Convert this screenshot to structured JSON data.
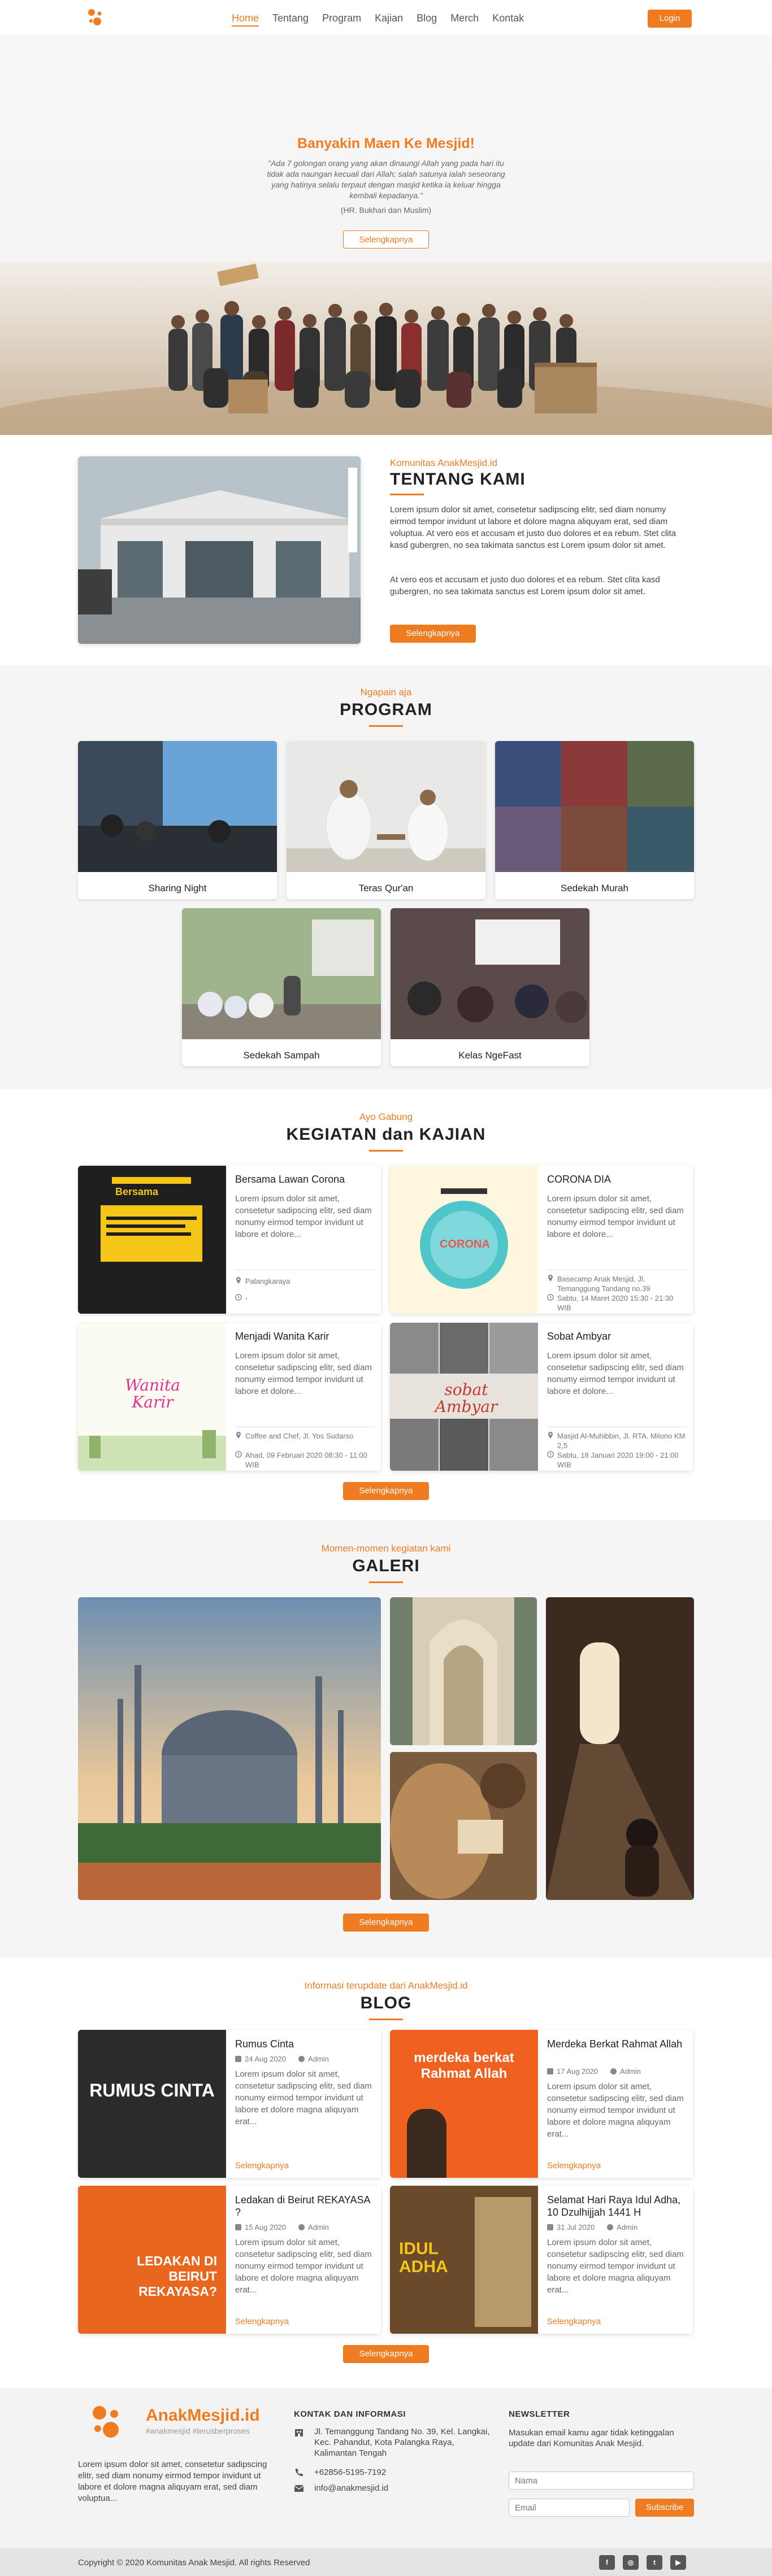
{
  "nav": {
    "items": [
      "Home",
      "Tentang",
      "Program",
      "Kajian",
      "Blog",
      "Merch",
      "Kontak"
    ],
    "active": "Home",
    "login": "Login"
  },
  "hero": {
    "title": "Banyakin Maen Ke Mesjid!",
    "quote": "\"Ada 7 golongan orang yang akan dinaungi Allah yang pada hari itu tidak ada naungan kecuali dari Allah; salah satunya ialah seseorang yang hatinya selalu terpaut dengan masjid ketika ia keluar hingga kembali kepadanya.\"",
    "cite": "(HR. Bukhari dan Muslim)",
    "button": "Selengkapnya"
  },
  "about": {
    "subtitle": "Komunitas AnakMesjid.id",
    "title": "TENTANG KAMI",
    "p1": "Lorem ipsum dolor sit amet, consetetur sadipscing elitr, sed diam nonumy eirmod tempor invidunt ut labore et dolore magna aliquyam erat, sed diam voluptua. At vero eos et accusam et justo duo dolores et ea rebum. Stet clita kasd gubergren, no sea takimata sanctus est Lorem ipsum dolor sit amet.",
    "p2": "At vero eos et accusam et justo duo dolores et ea rebum. Stet clita kasd gubergren, no sea takimata sanctus est Lorem ipsum dolor sit amet.",
    "button": "Selengkapnya"
  },
  "program": {
    "subtitle": "Ngapain aja",
    "title": "PROGRAM",
    "cards": [
      "Sharing Night",
      "Teras Qur'an",
      "Sedekah Murah",
      "Sedekah Sampah",
      "Kelas NgeFast"
    ]
  },
  "kajian": {
    "subtitle": "Ayo Gabung",
    "title": "KEGIATAN dan KAJIAN",
    "cards": [
      {
        "title": "Bersama Lawan Corona",
        "desc": "Lorem ipsum dolor sit amet, consetetur sadipscing elitr, sed diam nonumy eirmod tempor invidunt ut labore et dolore...",
        "place": "Palangkaraya",
        "time": "-"
      },
      {
        "title": "CORONA DIA",
        "desc": "Lorem ipsum dolor sit amet, consetetur sadipscing elitr, sed diam nonumy eirmod tempor invidunt ut labore et dolore...",
        "place": "Basecamp Anak Mesjid, Jl. Temanggung Tandang no.39",
        "time": "Sabtu, 14 Maret 2020 15:30 - 21:30 WIB"
      },
      {
        "title": "Menjadi Wanita Karir",
        "desc": "Lorem ipsum dolor sit amet, consetetur sadipscing elitr, sed diam nonumy eirmod tempor invidunt ut labore et dolore...",
        "place": "Coffee and Chef, Jl. Yos Sudarso",
        "time": "Ahad, 09 Februari 2020 08:30 - 11:00 WIB"
      },
      {
        "title": "Sobat Ambyar",
        "desc": "Lorem ipsum dolor sit amet, consetetur sadipscing elitr, sed diam nonumy eirmod tempor invidunt ut labore et dolore...",
        "place": "Masjid Al-Muhibbin, Jl. RTA. Milono KM 2,5",
        "time": "Sabtu, 18 Januari 2020 19:00 - 21:00 WIB"
      }
    ],
    "poster_texts": {
      "corona": "CORONA",
      "wanita": "Wanita Karir",
      "sobat": "sobat Ambyar",
      "bersama": "Bersama"
    },
    "button": "Selengkapnya"
  },
  "galeri": {
    "subtitle": "Momen-momen kegiatan kami",
    "title": "GALERI",
    "button": "Selengkapnya"
  },
  "blog": {
    "subtitle": "Informasi terupdate dari AnakMesjid.id",
    "title": "BLOG",
    "cards": [
      {
        "title": "Rumus Cinta",
        "date": "24 Aug 2020",
        "author": "Admin",
        "desc": "Lorem ipsum dolor sit amet, consetetur sadipscing elitr, sed diam nonumy eirmod tempor invidunt ut labore et dolore magna aliquyam erat...",
        "link": "Selengkapnya",
        "image_text": "RUMUS CINTA"
      },
      {
        "title": "Merdeka Berkat Rahmat Allah",
        "date": "17 Aug 2020",
        "author": "Admin",
        "desc": "Lorem ipsum dolor sit amet, consetetur sadipscing elitr, sed diam nonumy eirmod tempor invidunt ut labore et dolore magna aliquyam erat...",
        "link": "Selengkapnya",
        "image_text": "merdeka berkat Rahmat Allah"
      },
      {
        "title": "Ledakan di Beirut REKAYASA ?",
        "date": "15 Aug 2020",
        "author": "Admin",
        "desc": "Lorem ipsum dolor sit amet, consetetur sadipscing elitr, sed diam nonumy eirmod tempor invidunt ut labore et dolore magna aliquyam erat...",
        "link": "Selengkapnya",
        "image_text": "LEDAKAN DI BEIRUT REKAYASA?"
      },
      {
        "title": "Selamat Hari Raya Idul Adha, 10 Dzulhijjah 1441 H",
        "date": "31 Jul 2020",
        "author": "Admin",
        "desc": "Lorem ipsum dolor sit amet, consetetur sadipscing elitr, sed diam nonumy eirmod tempor invidunt ut labore et dolore magna aliquyam erat...",
        "link": "Selengkapnya",
        "image_text": "IDUL ADHA"
      }
    ],
    "button": "Selengkapnya"
  },
  "footer": {
    "brand": "AnakMesjid.id",
    "tagline": "#anakmesjid #terusberproses",
    "desc": "Lorem ipsum dolor sit amet, consetetur sadipscing elitr, sed diam nonumy eirmod tempor invidunt ut labore et dolore magna aliquyam erat, sed diam voluptua...",
    "contact_title": "KONTAK DAN INFORMASI",
    "address": "Jl. Temanggung Tandang No. 39, Kel. Langkai, Kec. Pahandut, Kota Palangka Raya, Kalimantan Tengah",
    "phone": "+62856-5195-7192",
    "email": "info@anakmesjid.id",
    "newsletter_title": "NEWSLETTER",
    "newsletter_desc": "Masukan email kamu agar tidak ketinggalan update dari Komunitas Anak Mesjid.",
    "name_placeholder": "Nama",
    "email_placeholder": "Email",
    "subscribe": "Subscribe"
  },
  "copyright": "Copyright © 2020 Komunitas Anak Mesjid. All rights Reserved",
  "social_icons": [
    "facebook-icon",
    "instagram-icon",
    "twitter-icon",
    "youtube-icon"
  ],
  "colors": {
    "accent": "#f07c22"
  }
}
